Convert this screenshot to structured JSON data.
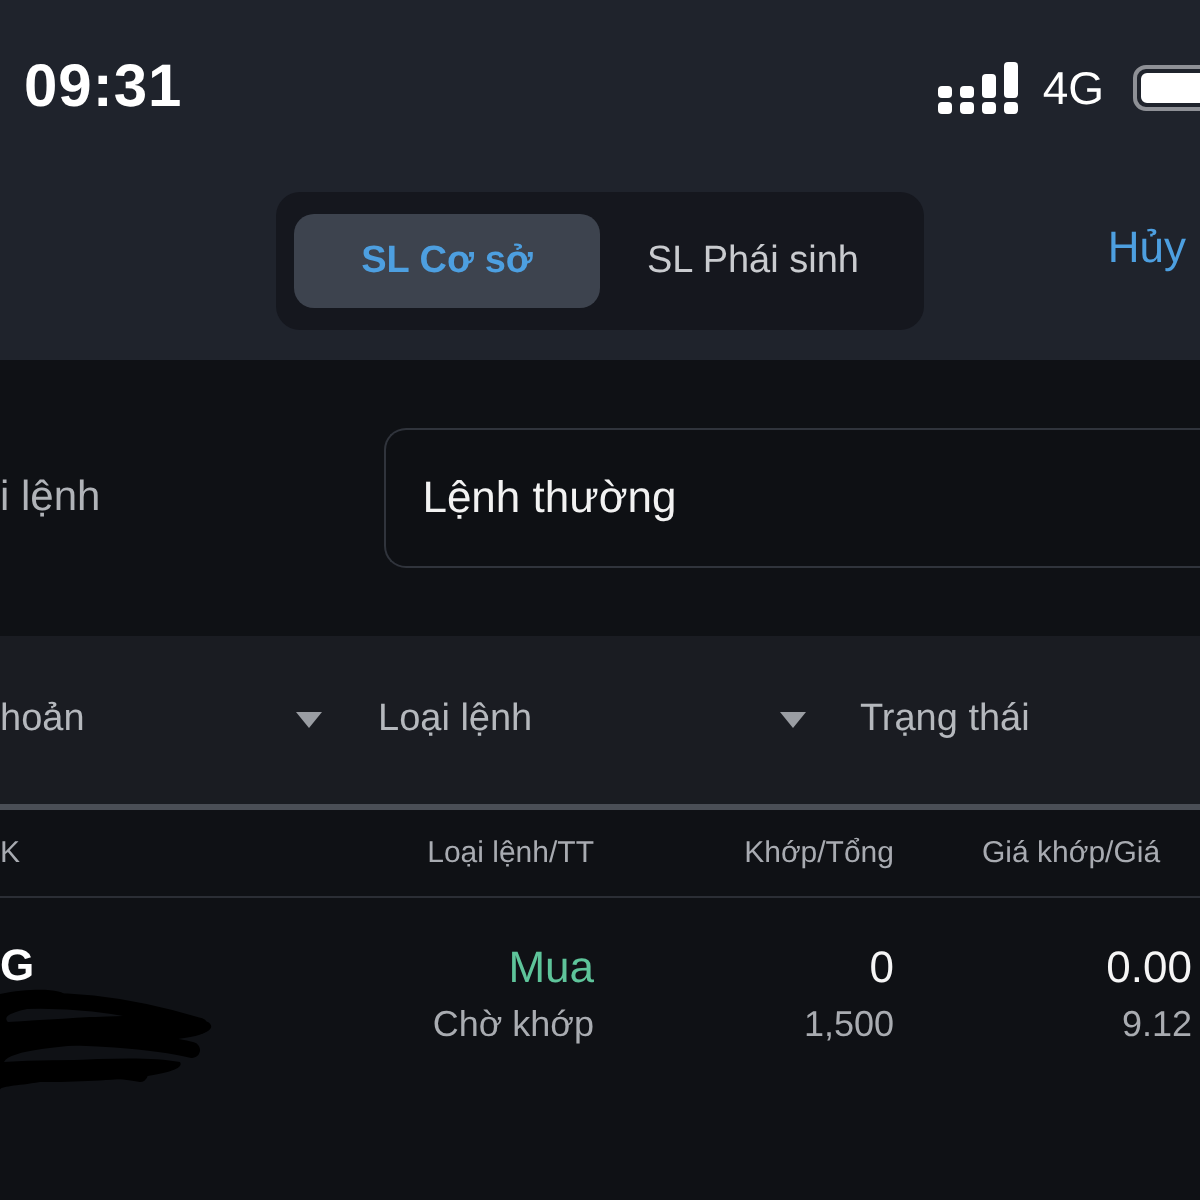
{
  "status_bar": {
    "time": "09:31",
    "network": "4G"
  },
  "header": {
    "segments": [
      {
        "label": "SL Cơ sở",
        "selected": true
      },
      {
        "label": "SL Phái sinh",
        "selected": false
      }
    ],
    "cancel": "Hủy"
  },
  "order_type_field": {
    "label": "i lệnh",
    "value": "Lệnh thường"
  },
  "filters": [
    {
      "label": "hoản",
      "kind": "dropdown"
    },
    {
      "label": "Loại lệnh",
      "kind": "dropdown"
    },
    {
      "label": "Trạng thái",
      "kind": "label"
    }
  ],
  "table": {
    "columns": [
      "K",
      "Loại lệnh/TT",
      "Khớp/Tổng",
      "Giá khớp/Giá"
    ],
    "rows": [
      {
        "symbol": "G",
        "side": "Mua",
        "status": "Chờ khớp",
        "matched": "0",
        "total": "1,500",
        "matched_price": "0.00",
        "order_price": "9.12"
      }
    ]
  }
}
